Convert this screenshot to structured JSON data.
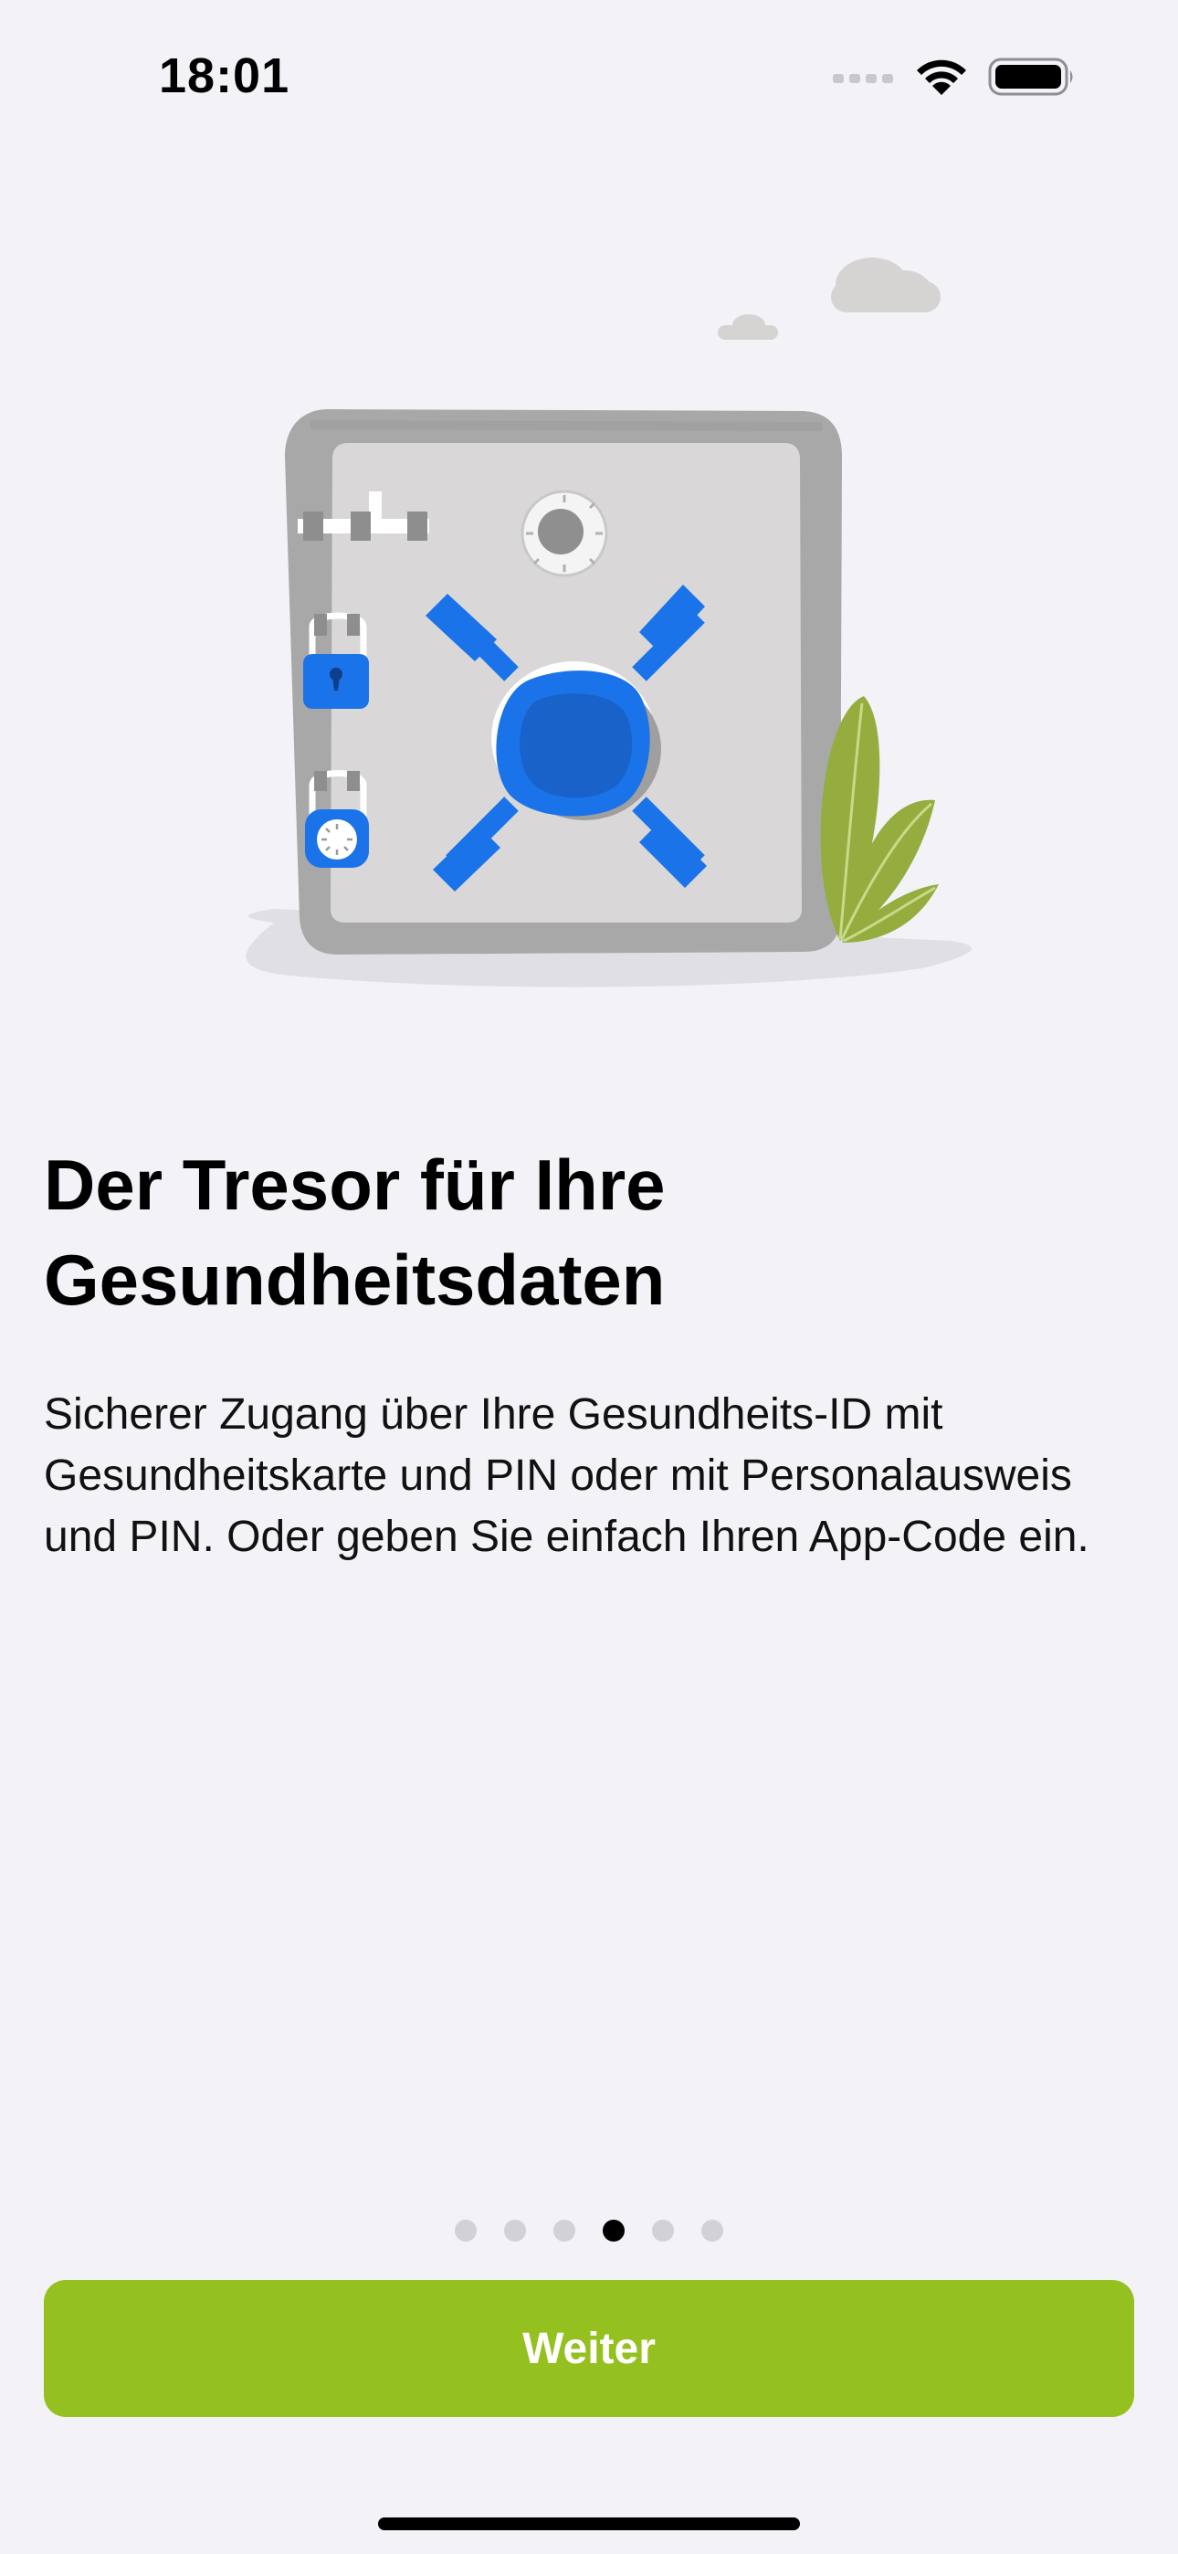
{
  "status_bar": {
    "time": "18:01",
    "icons": [
      "cellular-signal-icon",
      "wifi-icon",
      "battery-icon"
    ]
  },
  "illustration": {
    "name": "safe-illustration",
    "colors": {
      "safe_body": "#a8a8a8",
      "safe_door": "#d9d7d7",
      "accent_blue": "#1a73e8",
      "leaf_green": "#94ad3e",
      "cloud": "#d6d3d3",
      "shadow": "#e0dfe3"
    }
  },
  "content": {
    "title": "Der Tresor für Ihre Gesundheitsdaten",
    "body": "Sicherer Zugang über Ihre Gesundheits-ID mit Gesundheitskarte und PIN oder mit Personalausweis und PIN. Oder geben Sie einfach Ihren App-Code ein."
  },
  "pager": {
    "total": 6,
    "current_index": 3
  },
  "primary_action": {
    "label": "Weiter",
    "color": "#94c11f"
  }
}
